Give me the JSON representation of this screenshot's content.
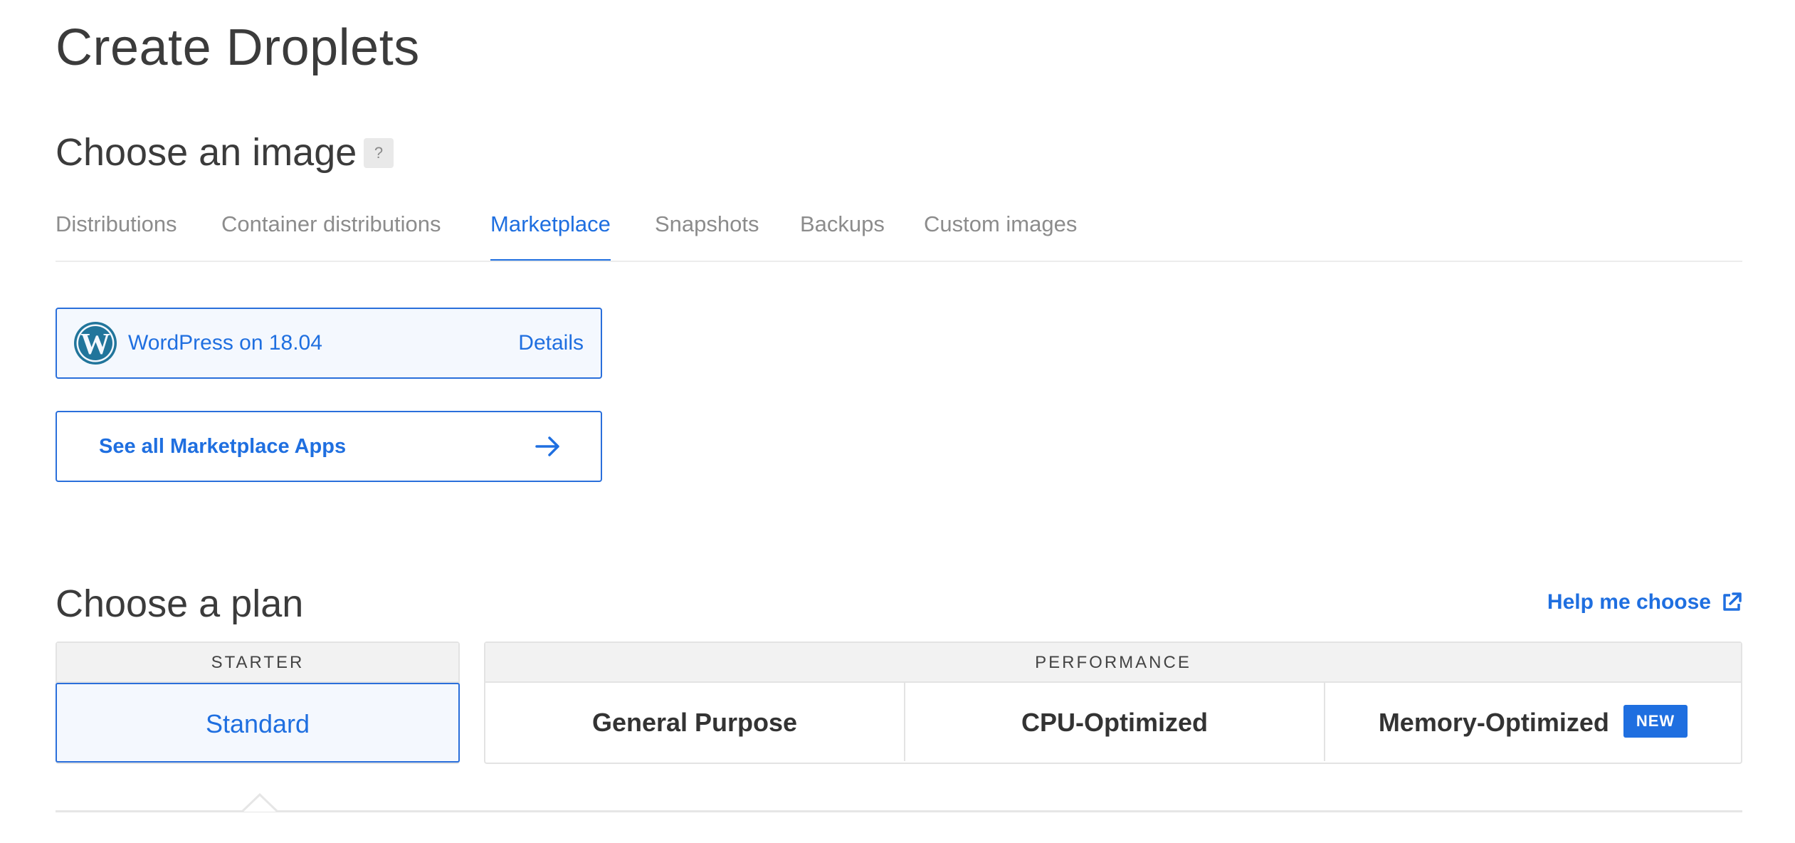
{
  "page": {
    "title": "Create Droplets"
  },
  "image_section": {
    "title": "Choose an image",
    "help_badge": "?",
    "tabs": [
      {
        "label": "Distributions",
        "active": false
      },
      {
        "label": "Container distributions",
        "active": false
      },
      {
        "label": "Marketplace",
        "active": true
      },
      {
        "label": "Snapshots",
        "active": false
      },
      {
        "label": "Backups",
        "active": false
      },
      {
        "label": "Custom images",
        "active": false
      }
    ],
    "selected_app": {
      "name": "WordPress on 18.04",
      "details_label": "Details",
      "icon": "wordpress-logo-icon"
    },
    "see_all": {
      "label": "See all Marketplace Apps",
      "icon": "arrow-right-icon"
    }
  },
  "plan_section": {
    "title": "Choose a plan",
    "help_link": {
      "label": "Help me choose",
      "icon": "external-link-icon"
    },
    "groups": [
      {
        "header": "STARTER",
        "plans": [
          {
            "label": "Standard",
            "selected": true
          }
        ]
      },
      {
        "header": "PERFORMANCE",
        "plans": [
          {
            "label": "General Purpose",
            "selected": false
          },
          {
            "label": "CPU-Optimized",
            "selected": false
          },
          {
            "label": "Memory-Optimized",
            "selected": false,
            "badge": "NEW"
          }
        ]
      }
    ]
  },
  "colors": {
    "accent": "#1f6fe0",
    "wordpress": "#21759b",
    "header_bg": "#f2f2f2",
    "selected_bg": "#f4f8fe"
  }
}
